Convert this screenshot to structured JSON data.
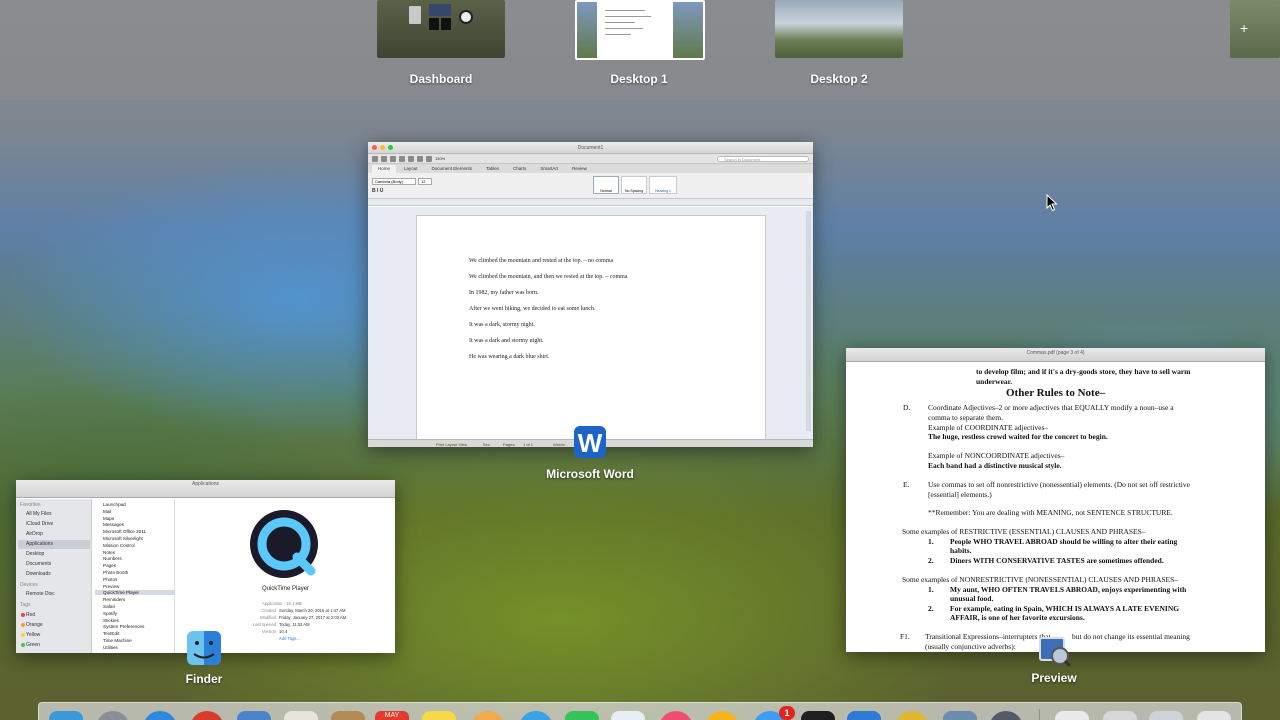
{
  "spaces": [
    {
      "label": "Dashboard"
    },
    {
      "label": "Desktop 1"
    },
    {
      "label": "Desktop 2"
    }
  ],
  "windows": {
    "word": {
      "app_label": "Microsoft Word",
      "title": "Document1",
      "search_placeholder": "Search in Document",
      "tabs": [
        "Home",
        "Layout",
        "Document Elements",
        "Tables",
        "Charts",
        "SmartArt",
        "Review"
      ],
      "font_name": "Cambria (Body)",
      "font_size": "12",
      "zoom": "150%",
      "styles": [
        "Normal",
        "No Spacing",
        "Heading 1"
      ],
      "lines": [
        "We climbed the mountain and rested at the top.  – no comma",
        "We climbed the mountain, and then we rested at the top. – comma",
        "In 1982, my father was born.",
        "After we went hiking, we decided to eat some lunch.",
        "It was a dark, stormy night.",
        "It was a dark and stormy night.",
        "He was wearing a dark blue shirt."
      ],
      "status": {
        "view": "Print Layout View",
        "sec": "Sec",
        "pages_label": "Pages:",
        "pages": "1 of 1",
        "words": "Words:"
      }
    },
    "preview": {
      "app_label": "Preview",
      "title": "Commas.pdf (page 3 of 4)",
      "lines": [
        "to develop film; and if it's a dry-goods store, they have to sell warm",
        "underwear.",
        "Other Rules to Note–",
        "D.",
        "Coordinate Adjectives–2 or more adjectives that EQUALLY modify a noun–use a",
        "comma to separate them.",
        "Example of COORDINATE adjectives–",
        "The huge, restless crowd waited for the concert to begin.",
        "Example of NONCOORDINATE adjectives–",
        "Each band had a distinctive musical style.",
        "E.",
        "Use commas to set off nonrestrictive (nonessential) elements.  (Do not set off restrictive",
        "[essential] elements.)",
        "**Remember:  You are dealing with MEANING, not SENTENCE STRUCTURE.",
        "Some examples of RESTRICTIVE (ESSENTIAL) CLAUSES AND PHRASES–",
        "1.",
        "People WHO TRAVEL ABROAD should be willing to alter their eating",
        "habits.",
        "2.",
        "Diners WITH CONSERVATIVE TASTES are sometimes offended.",
        "Some examples of NONRESTRICTIVE (NONESSENTIAL) CLAUSES AND PHRASES–",
        "1.",
        "My aunt, WHO OFTEN TRAVELS ABROAD, enjoys experimenting with",
        "unusual food.",
        "2.",
        "For example, eating in Spain, WHICH IS ALWAYS A LATE EVENING",
        "AFFAIR, is one of her favorite excursions.",
        "F1.",
        "Transitional Expressions–interrupters that ",
        "but do not change its essential meaning",
        "(usually conjunctive adverbs):"
      ]
    },
    "finder": {
      "app_label": "Finder",
      "title": "Applications",
      "sidebar": {
        "favorites_header": "Favorites",
        "favorites": [
          "All My Files",
          "iCloud Drive",
          "AirDrop",
          "Applications",
          "Desktop",
          "Documents",
          "Downloads"
        ],
        "devices_header": "Devices",
        "devices": [
          "Remote Disc"
        ],
        "tags_header": "Tags",
        "tags": [
          "Red",
          "Orange",
          "Yellow",
          "Green"
        ]
      },
      "apps": [
        "Launchpad",
        "Mail",
        "Maps",
        "Messages",
        "Microsoft Office 2011",
        "Microsoft Silverlight",
        "Mission Control",
        "Notes",
        "Numbers",
        "Pages",
        "Photo Booth",
        "Photos",
        "Preview",
        "QuickTime Player",
        "Reminders",
        "Safari",
        "Spotify",
        "Stickies",
        "System Preferences",
        "TextEdit",
        "Time Machine",
        "Utilities"
      ],
      "selected_app": "QuickTime Player",
      "preview": {
        "name": "QuickTime Player",
        "kind_size": "Application - 16.1 MB",
        "created_label": "Created",
        "created": "Sunday, March 20, 2016 at 1:47 AM",
        "modified_label": "Modified",
        "modified": "Friday, January 27, 2017 at 2:03 AM",
        "last_opened_label": "Last opened",
        "last_opened": "Today, 11:53 AM",
        "version_label": "Version",
        "version": "10.4",
        "add_tags": "Add Tags..."
      }
    }
  },
  "dock": {
    "badge_count": "1",
    "calendar_month": "MAY"
  }
}
